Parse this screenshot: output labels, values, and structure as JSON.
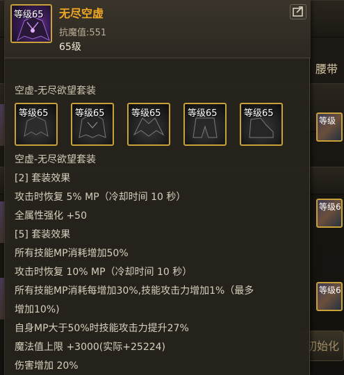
{
  "item": {
    "level_badge": "等级65",
    "name": "无尽空虚",
    "resist": "抗魔值:551",
    "level": "65级"
  },
  "set": {
    "title": "空虚-无尽欲望套装",
    "pieces": [
      {
        "level_badge": "等级65"
      },
      {
        "level_badge": "等级65"
      },
      {
        "level_badge": "等级65"
      },
      {
        "level_badge": "等级65"
      },
      {
        "level_badge": "等级65"
      }
    ],
    "description_lines": [
      "空虚-无尽欲望套装",
      "[2] 套装效果",
      "攻击时恢复 5% MP（冷却时间 10 秒）",
      "全属性强化 +50",
      "[5] 套装效果",
      "所有技能MP消耗增加50%",
      "攻击时恢复 10% MP（冷却时间 10 秒）",
      "所有技能MP消耗每增加30%,技能攻击力增加1%（最多",
      "增加10%)",
      "自身MP大于50%时技能攻击力提升27%",
      "魔法值上限 +3000(实际+25224)",
      "伤害增加 20%"
    ]
  },
  "background": {
    "tab_label": "腰带",
    "slot_badge_1": "等级",
    "slot_badge_2": "等级6",
    "slot_badge_3": "等级6",
    "button_label": "初始化"
  },
  "colors": {
    "item_name": "#f0a824",
    "slot_border": "#c9a23a",
    "text": "#d8d0bd"
  },
  "icons": {
    "share": "share-icon"
  }
}
